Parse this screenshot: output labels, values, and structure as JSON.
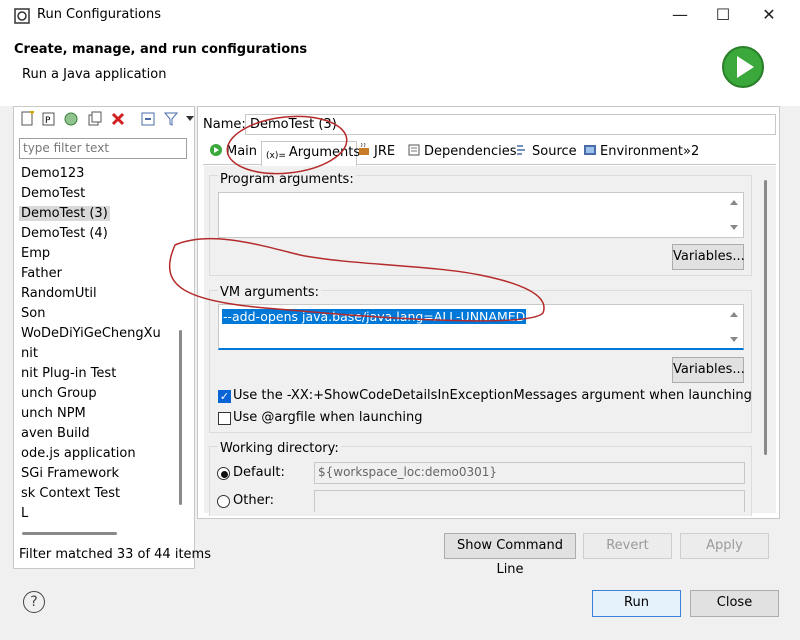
{
  "window": {
    "title": "Run Configurations",
    "minimize": "—",
    "maximize": "☐",
    "close": "✕"
  },
  "header": {
    "title": "Create, manage, and run configurations",
    "subtitle": "Run a Java application"
  },
  "left": {
    "filter_placeholder": "type filter text",
    "items": [
      "Demo123",
      "DemoTest",
      "DemoTest (3)",
      "DemoTest (4)",
      "Emp",
      "Father",
      "RandomUtil",
      "Son",
      "WoDeDiYiGeChengXu",
      "nit",
      "nit Plug-in Test",
      "unch Group",
      "unch NPM",
      "aven Build",
      "ode.js application",
      "SGi Framework",
      "sk Context Test",
      "L"
    ],
    "selected_index": 2,
    "status": "Filter matched 33 of 44 items"
  },
  "config": {
    "name_label": "Name:",
    "name_value": "DemoTest (3)",
    "tabs": [
      "Main",
      "Arguments",
      "JRE",
      "Dependencies",
      "Source",
      "Environment",
      "»2"
    ],
    "active_tab": 1,
    "program_args_label": "Program arguments:",
    "program_args_value": "",
    "variables_label": "Variables...",
    "vm_args_label": "VM arguments:",
    "vm_args_value": "--add-opens java.base/java.lang=ALL-UNNAMED",
    "show_code_details_label": "Use the -XX:+ShowCodeDetailsInExceptionMessages argument when launching",
    "show_code_details_checked": true,
    "argfile_label": "Use @argfile when launching",
    "argfile_checked": false,
    "working_dir_label": "Working directory:",
    "default_label": "Default:",
    "default_value": "${workspace_loc:demo0301}",
    "other_label": "Other:",
    "other_value": ""
  },
  "buttons": {
    "show_command_line": "Show Command Line",
    "revert": "Revert",
    "apply": "Apply",
    "run": "Run",
    "close": "Close",
    "help": "?"
  },
  "colors": {
    "selection": "#0078d7",
    "annotation": "#b52a2a",
    "run_icon": "#3aa83a"
  }
}
